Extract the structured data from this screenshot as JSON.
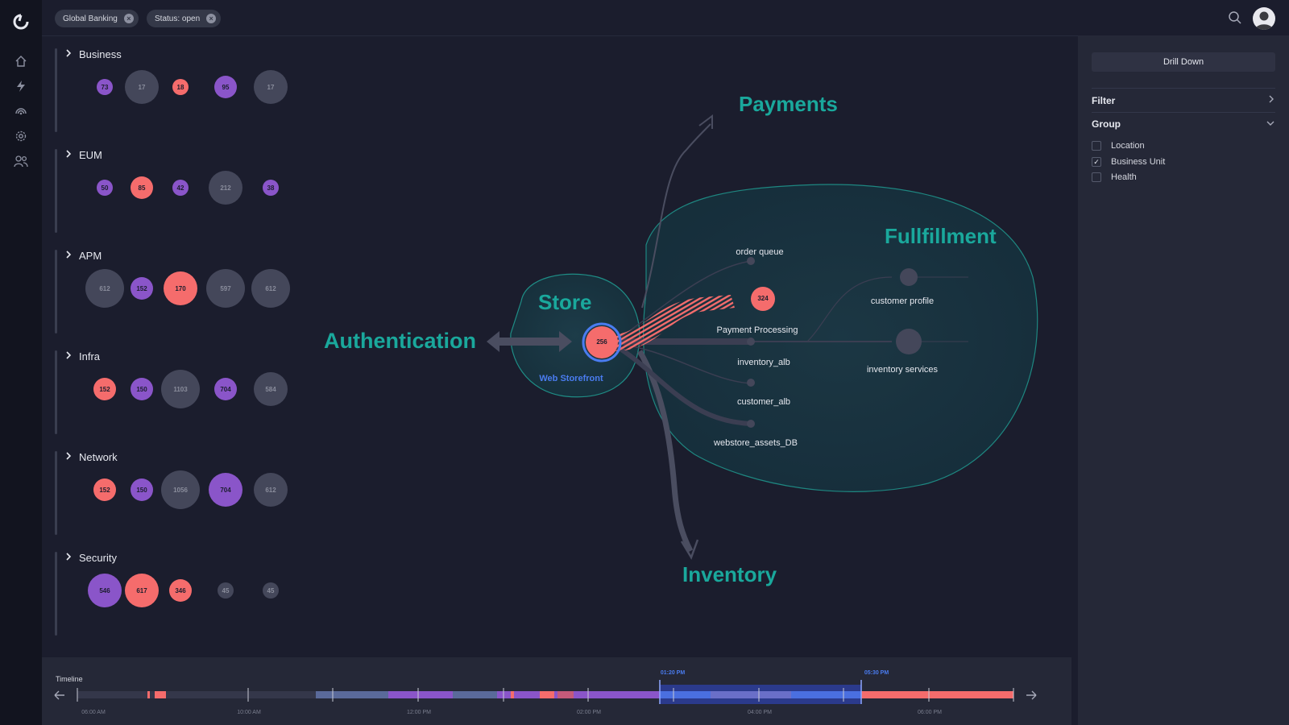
{
  "filters": [
    {
      "label": "Global Banking"
    },
    {
      "label": "Status: open"
    }
  ],
  "nav_icons": [
    "logo-icon",
    "home-icon",
    "lightning-icon",
    "signal-icon",
    "gear-icon",
    "users-icon"
  ],
  "groups": [
    {
      "name": "Business",
      "bubbles": [
        {
          "value": "73",
          "status": "purple",
          "size": "small"
        },
        {
          "value": "17",
          "status": "gray",
          "size": "large"
        },
        {
          "value": "18",
          "status": "red",
          "size": "small"
        },
        {
          "value": "95",
          "status": "purple",
          "size": "medium"
        },
        {
          "value": "17",
          "status": "gray",
          "size": "large"
        }
      ]
    },
    {
      "name": "EUM",
      "bubbles": [
        {
          "value": "50",
          "status": "purple",
          "size": "small"
        },
        {
          "value": "85",
          "status": "red",
          "size": "medium"
        },
        {
          "value": "42",
          "status": "purple",
          "size": "small"
        },
        {
          "value": "212",
          "status": "gray",
          "size": "large"
        },
        {
          "value": "38",
          "status": "purple",
          "size": "small"
        }
      ]
    },
    {
      "name": "APM",
      "bubbles": [
        {
          "value": "612",
          "status": "gray",
          "size": "xlarge"
        },
        {
          "value": "152",
          "status": "purple",
          "size": "medium"
        },
        {
          "value": "170",
          "status": "red",
          "size": "large"
        },
        {
          "value": "597",
          "status": "gray",
          "size": "xlarge"
        },
        {
          "value": "612",
          "status": "gray",
          "size": "xlarge"
        }
      ]
    },
    {
      "name": "Infra",
      "bubbles": [
        {
          "value": "152",
          "status": "red",
          "size": "medium"
        },
        {
          "value": "150",
          "status": "purple",
          "size": "medium"
        },
        {
          "value": "1103",
          "status": "gray",
          "size": "xlarge"
        },
        {
          "value": "704",
          "status": "purple",
          "size": "medium"
        },
        {
          "value": "584",
          "status": "gray",
          "size": "large"
        }
      ]
    },
    {
      "name": "Network",
      "bubbles": [
        {
          "value": "152",
          "status": "red",
          "size": "medium"
        },
        {
          "value": "150",
          "status": "purple",
          "size": "medium"
        },
        {
          "value": "1056",
          "status": "gray",
          "size": "xlarge"
        },
        {
          "value": "704",
          "status": "purple",
          "size": "large"
        },
        {
          "value": "612",
          "status": "gray",
          "size": "large"
        }
      ]
    },
    {
      "name": "Security",
      "bubbles": [
        {
          "value": "546",
          "status": "purple",
          "size": "large"
        },
        {
          "value": "617",
          "status": "red",
          "size": "large"
        },
        {
          "value": "346",
          "status": "red",
          "size": "medium"
        },
        {
          "value": "45",
          "status": "gray",
          "size": "small"
        },
        {
          "value": "45",
          "status": "gray",
          "size": "small"
        }
      ]
    }
  ],
  "map": {
    "domains": {
      "payments": "Payments",
      "authentication": "Authentication",
      "store": "Store",
      "fulfillment": "Fullfillment",
      "inventory": "Inventory"
    },
    "storefront": {
      "value": "256",
      "label": "Web Storefront"
    },
    "payment_processing": {
      "value": "324",
      "label": "Payment Processing"
    },
    "nodes": {
      "order_queue": "order queue",
      "inventory_alb": "inventory_alb",
      "customer_alb": "customer_alb",
      "webstore_assets": "webstore_assets_DB",
      "customer_profile": "customer profile",
      "inventory_services": "inventory services"
    }
  },
  "right_panel": {
    "drill_down": "Drill Down",
    "filter": "Filter",
    "group": "Group",
    "options": [
      {
        "label": "Location",
        "checked": false
      },
      {
        "label": "Business Unit",
        "checked": true
      },
      {
        "label": "Health",
        "checked": false
      }
    ]
  },
  "timeline": {
    "label": "Timeline",
    "ticks": [
      "06:00 AM",
      "10:00 AM",
      "12:00 PM",
      "02:00 PM",
      "04:00 PM",
      "06:00 PM"
    ],
    "selection_start": "01:20 PM",
    "selection_end": "05:30 PM"
  },
  "colors": {
    "accent_teal": "#1aa89c",
    "critical": "#f56c6c",
    "warning": "#8a55c9",
    "selection": "#4a7cf0",
    "neutral": "#44475a"
  }
}
